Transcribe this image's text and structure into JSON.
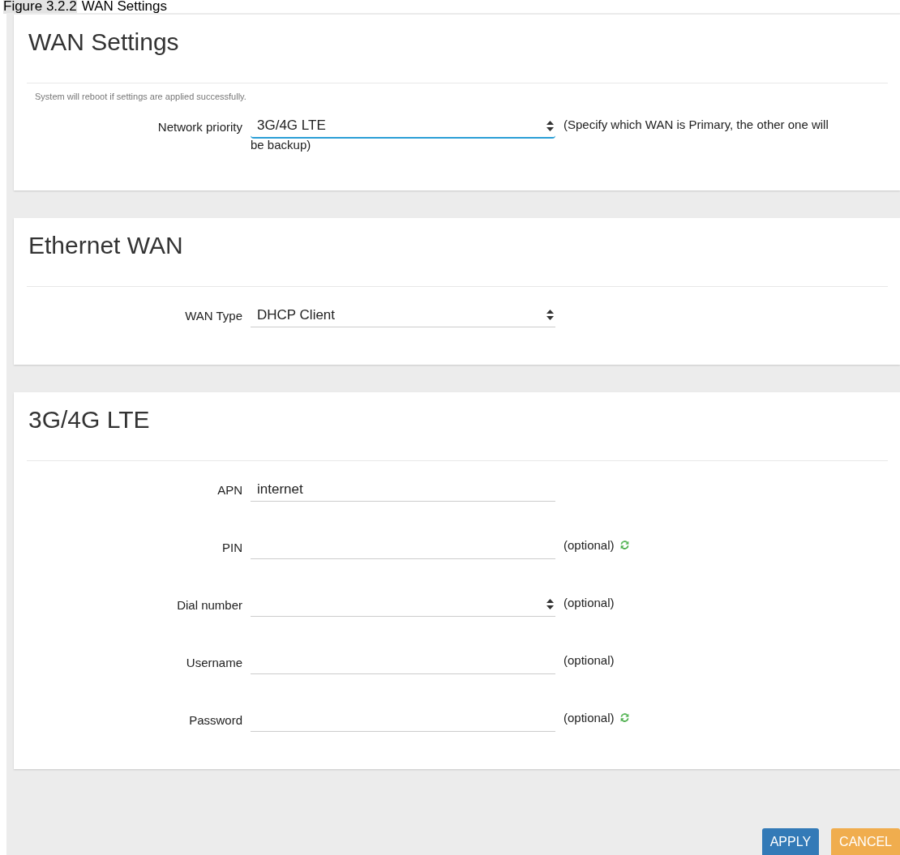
{
  "caption": {
    "number": "Figure 3.2.2",
    "title": "WAN Settings"
  },
  "sections": [
    {
      "title": "WAN Settings",
      "notice": "System will reboot if settings are applied successfully.",
      "fields": [
        {
          "label": "Network priority",
          "kind": "select",
          "value": "3G/4G LTE",
          "focused": true,
          "note": "(Specify which WAN is Primary, the other one will",
          "note_continued": "be backup)",
          "refresh": false
        }
      ]
    },
    {
      "title": "Ethernet WAN",
      "fields": [
        {
          "label": "WAN Type",
          "kind": "select",
          "value": "DHCP Client",
          "focused": false,
          "refresh": false
        }
      ]
    },
    {
      "title": "3G/4G LTE",
      "fields": [
        {
          "label": "APN",
          "kind": "text",
          "value": "internet",
          "focused": false,
          "refresh": false
        },
        {
          "label": "PIN",
          "kind": "text",
          "focused": false,
          "note": "(optional)",
          "refresh": true
        },
        {
          "label": "Dial number",
          "kind": "select",
          "focused": false,
          "note": "(optional)",
          "refresh": false
        },
        {
          "label": "Username",
          "kind": "text",
          "focused": false,
          "note": "(optional)",
          "refresh": false
        },
        {
          "label": "Password",
          "kind": "text",
          "focused": false,
          "note": "(optional)",
          "refresh": true
        }
      ]
    }
  ],
  "buttons": [
    {
      "label": "APPLY",
      "kind": "primary"
    },
    {
      "label": "CANCEL",
      "kind": "warning"
    }
  ]
}
